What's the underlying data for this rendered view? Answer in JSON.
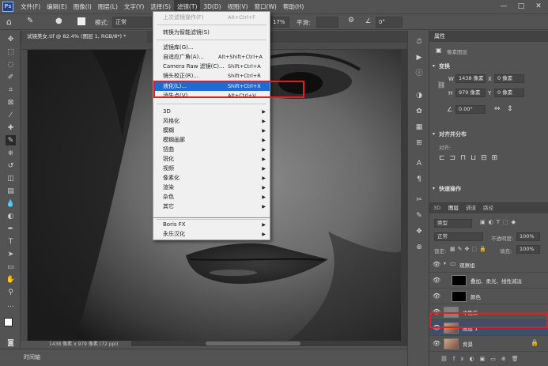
{
  "menubar": {
    "items": [
      "文件(F)",
      "编辑(E)",
      "图像(I)",
      "图层(L)",
      "文字(Y)",
      "选择(S)",
      "滤镜(T)",
      "3D(D)",
      "视图(V)",
      "窗口(W)",
      "帮助(H)"
    ],
    "minimize": "—",
    "maximize": "□",
    "close": "✕"
  },
  "optbar": {
    "mode_label": "模式:",
    "mode_value": "正常",
    "percent": "17%",
    "smooth_label": "平滑:",
    "angle": "0°"
  },
  "document": {
    "tab_title": "试镜美女.tif @ 82.4% (图层 1, RGB/8*) *",
    "status": "1438 像素 x 979 像素 (72 ppi)"
  },
  "timeline": {
    "label": "时间轴"
  },
  "filter_menu": {
    "items": [
      {
        "label": "上次滤镜操作(F)",
        "shortcut": "Alt+Ctrl+F",
        "disabled": true
      },
      {
        "label": "转换为智能滤镜(S)"
      },
      {
        "label": "滤镜库(G)..."
      },
      {
        "label": "自适应广角(A)...",
        "shortcut": "Alt+Shift+Ctrl+A"
      },
      {
        "label": "Camera Raw 滤镜(C)...",
        "shortcut": "Shift+Ctrl+A"
      },
      {
        "label": "镜头校正(R)...",
        "shortcut": "Shift+Ctrl+R"
      },
      {
        "label": "液化(L)...",
        "shortcut": "Shift+Ctrl+X",
        "highlighted": true
      },
      {
        "label": "消失点(V)...",
        "shortcut": "Alt+Ctrl+V"
      },
      {
        "label": "3D",
        "submenu": true
      },
      {
        "label": "风格化",
        "submenu": true
      },
      {
        "label": "模糊",
        "submenu": true
      },
      {
        "label": "模糊画廊",
        "submenu": true
      },
      {
        "label": "扭曲",
        "submenu": true
      },
      {
        "label": "锐化",
        "submenu": true
      },
      {
        "label": "视频",
        "submenu": true
      },
      {
        "label": "像素化",
        "submenu": true
      },
      {
        "label": "渲染",
        "submenu": true
      },
      {
        "label": "杂色",
        "submenu": true
      },
      {
        "label": "其它",
        "submenu": true
      },
      {
        "label": "Boris FX",
        "submenu": true
      },
      {
        "label": "永乐汉化",
        "submenu": true
      }
    ]
  },
  "properties": {
    "title": "属性",
    "type_label": "像素图层",
    "transform_label": "变换",
    "w_label": "W",
    "w_value": "1438 像素",
    "x_label": "X",
    "x_value": "0 像素",
    "h_label": "H",
    "h_value": "979 像素",
    "y_label": "Y",
    "y_value": "0 像素",
    "angle_value": "0.00°",
    "align_label": "对齐并分布",
    "align_sub": "对齐:",
    "quick_label": "快速操作"
  },
  "layers": {
    "tabs": [
      "3D",
      "图层",
      "通道",
      "路径"
    ],
    "filter_label": "类型",
    "blend_mode": "正常",
    "opacity_label": "不透明度:",
    "opacity_value": "100%",
    "lock_label": "锁定:",
    "fill_label": "填充:",
    "fill_value": "100%",
    "rows": [
      {
        "name": "观察组"
      },
      {
        "name": "叠加、柔光、线性减淡"
      },
      {
        "name": "颜色"
      },
      {
        "name": "中性灰"
      },
      {
        "name": "图层 1"
      },
      {
        "name": "背景"
      }
    ]
  },
  "colors": {
    "accent": "#1f6cd1",
    "highlight_box": "#e02020"
  }
}
